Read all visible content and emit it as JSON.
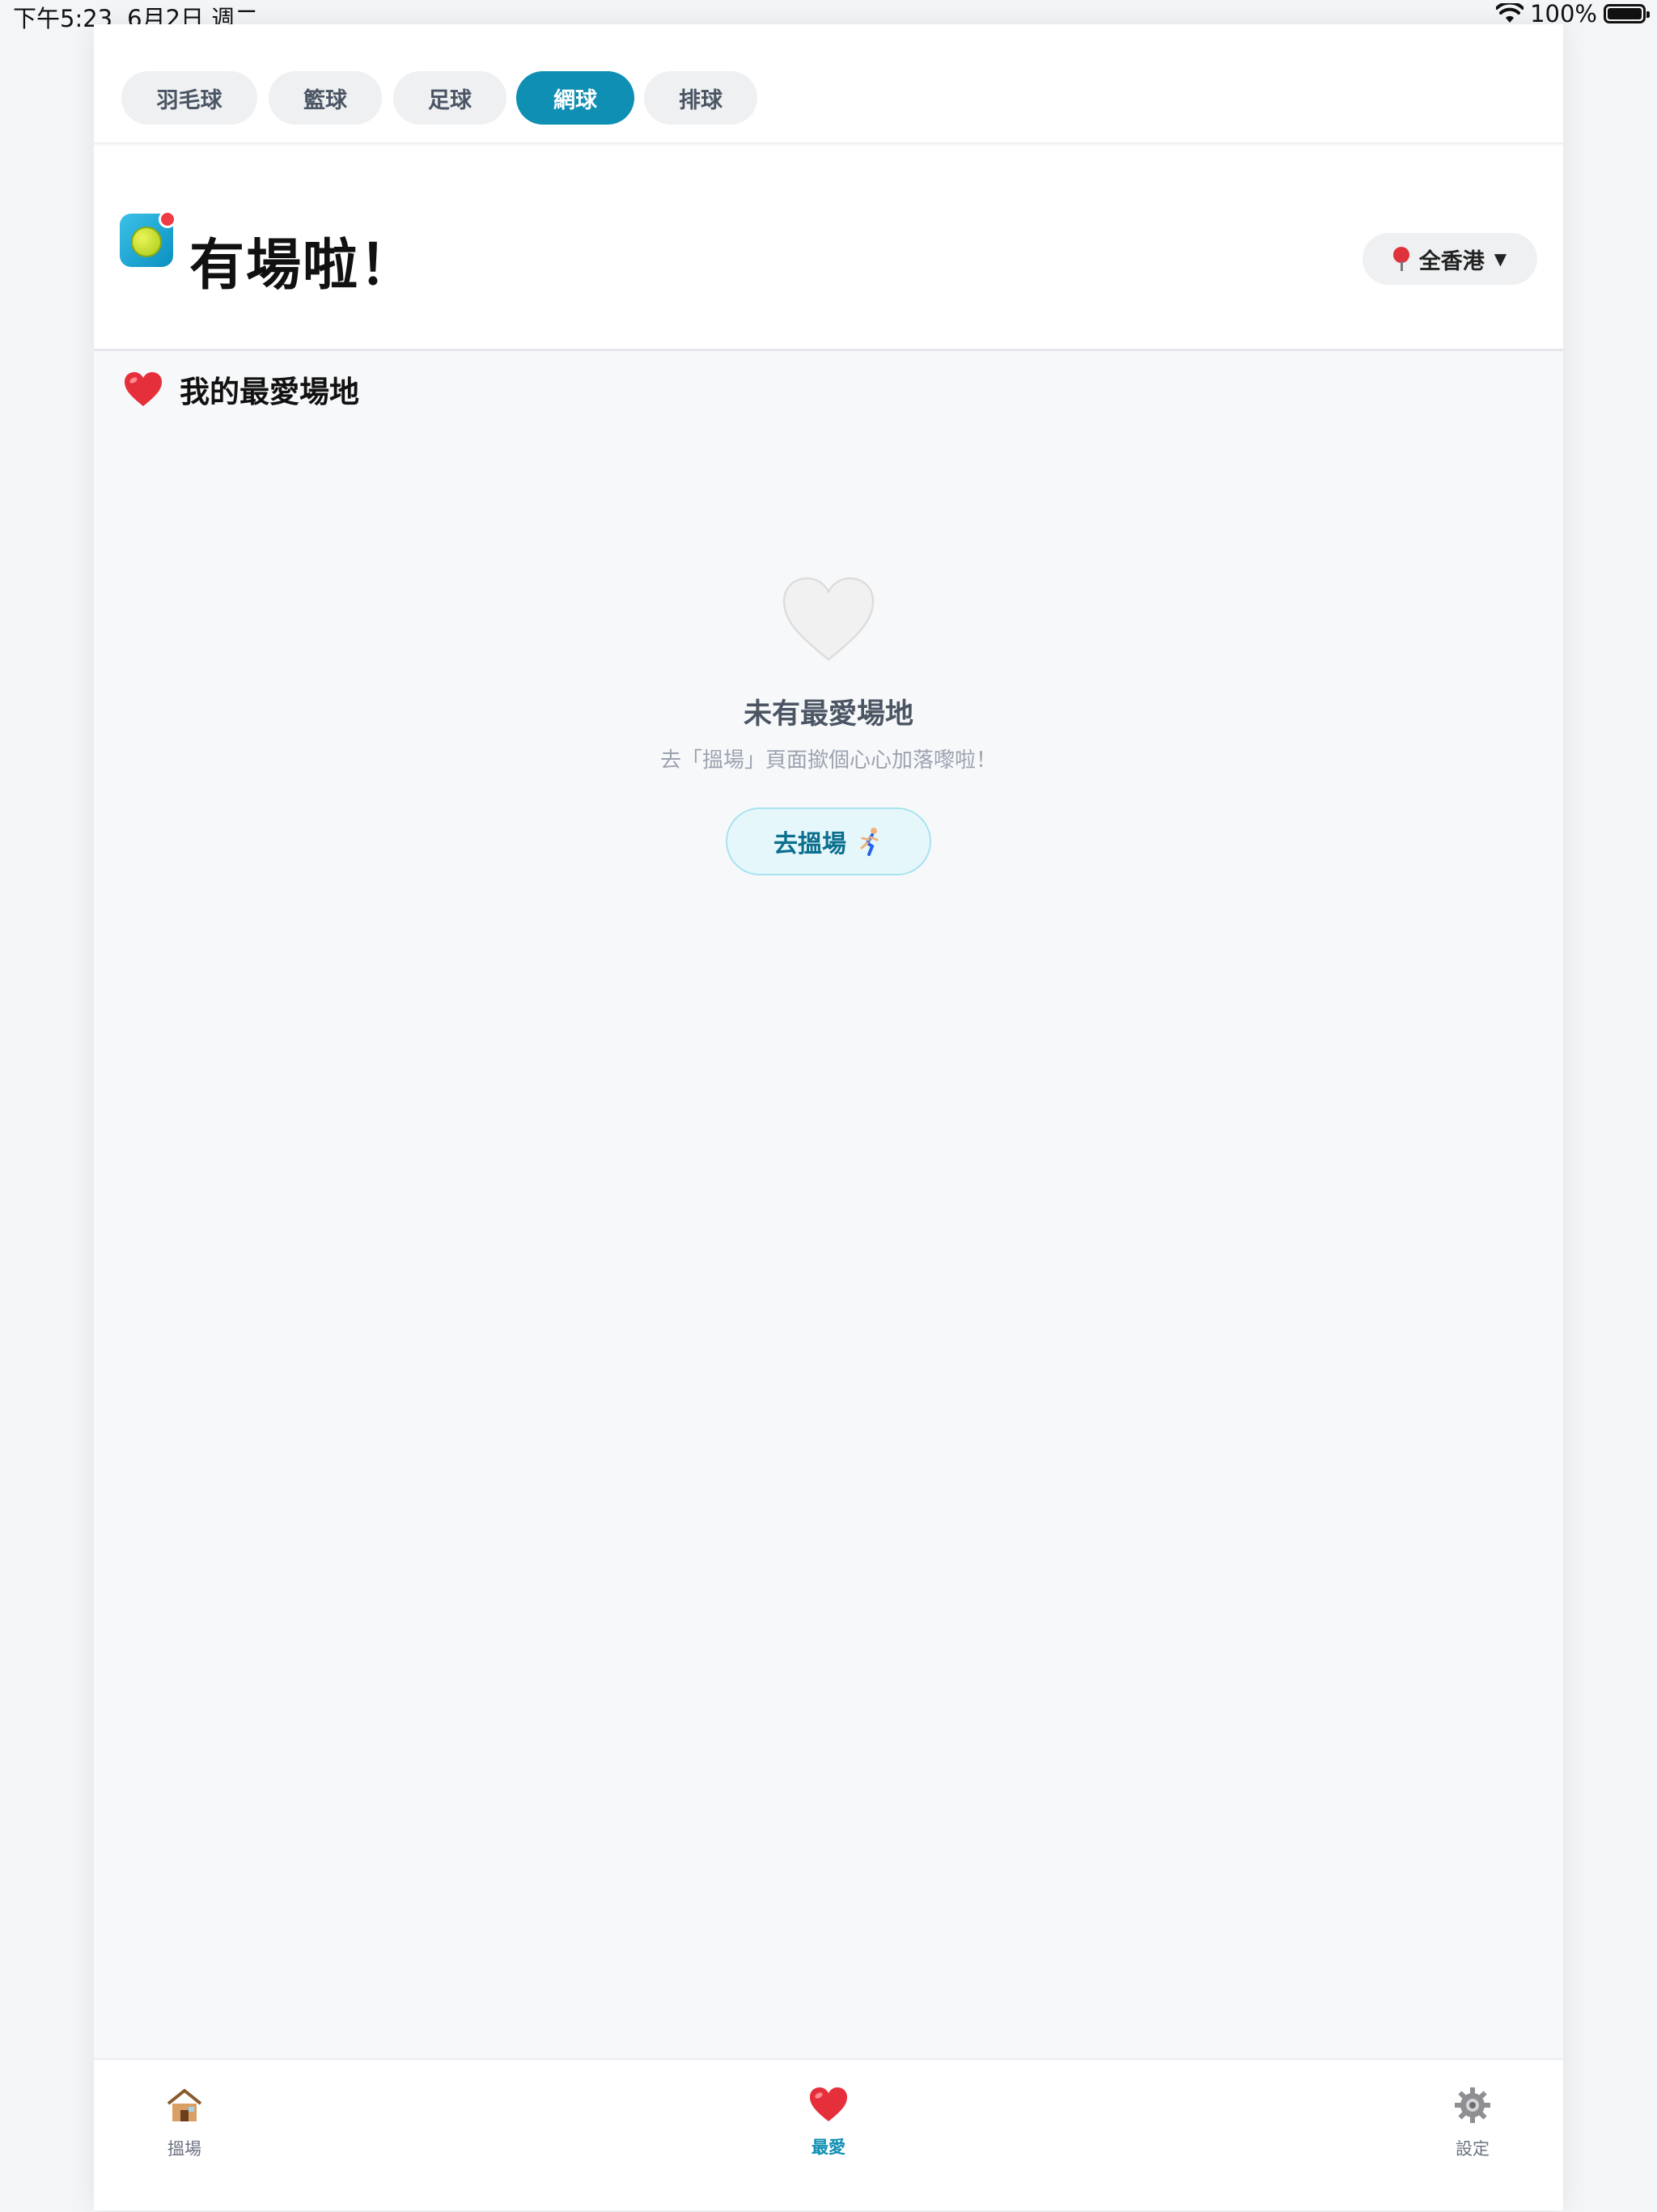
{
  "status_bar": {
    "time": "下午5:23",
    "date": "6月2日 週二",
    "battery": "100%",
    "battery_level": 1.0
  },
  "sports": [
    {
      "label": "羽毛球",
      "active": false
    },
    {
      "label": "籃球",
      "active": false
    },
    {
      "label": "足球",
      "active": false
    },
    {
      "label": "網球",
      "active": true
    },
    {
      "label": "排球",
      "active": false
    }
  ],
  "header": {
    "title": "有場啦！",
    "region": "全香港"
  },
  "favorites": {
    "section_title": "我的最愛場地",
    "empty_title": "未有最愛場地",
    "empty_subtitle": "去「搵場」頁面撳個心心加落嚟啦！",
    "cta_label": "去搵場"
  },
  "tabs": [
    {
      "label": "搵場",
      "icon": "house-icon",
      "active": false
    },
    {
      "label": "最愛",
      "icon": "heart-icon",
      "active": true
    },
    {
      "label": "設定",
      "icon": "gear-icon",
      "active": false
    }
  ],
  "colors": {
    "accent": "#0e8fb3",
    "heart_red": "#e5303c",
    "background": "#f7f8fa"
  }
}
